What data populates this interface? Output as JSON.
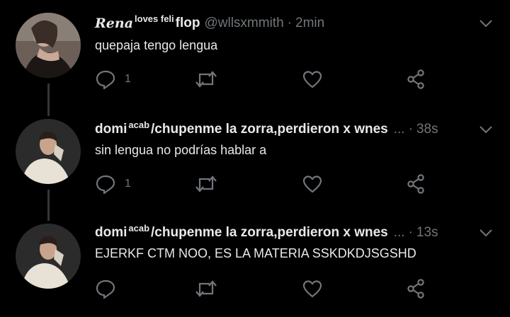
{
  "tweets": [
    {
      "name": "Rena",
      "name_sup": "loves feli",
      "name_suffix": "flop",
      "handle": "@wllsxmmith",
      "separator": "·",
      "time": "2min",
      "text": "quepaja tengo lengua",
      "reply_count": "1",
      "colors": {
        "avatar_bg": "#6b5f58"
      }
    },
    {
      "name": "domi",
      "name_sup": "acab",
      "name_suffix": "/chupenme la zorra,perdieron x wnes",
      "ellipsis": "...",
      "separator": "·",
      "time": "38s",
      "text": "sin lengua no podrías hablar a",
      "reply_count": "1",
      "colors": {
        "avatar_bg": "#2b2b2b"
      }
    },
    {
      "name": "domi",
      "name_sup": "acab",
      "name_suffix": "/chupenme la zorra,perdieron x wnes",
      "ellipsis": "...",
      "separator": "·",
      "time": "13s",
      "text": "EJERKF CTM NOO, ES LA MATERIA SSKDKDJSGSHD",
      "reply_count": "",
      "colors": {
        "avatar_bg": "#2b2b2b"
      }
    }
  ],
  "icons": {
    "reply": "reply-icon",
    "retweet": "retweet-icon",
    "like": "heart-icon",
    "share": "share-icon",
    "more": "chevron-down-icon"
  },
  "colors": {
    "background": "#000000",
    "text": "#e7e9ea",
    "muted": "#71767b",
    "thread_line": "#333639"
  }
}
